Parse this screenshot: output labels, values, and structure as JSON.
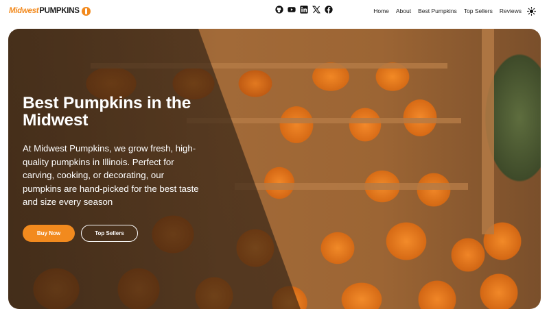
{
  "brand": {
    "logo_word1": "Midwest",
    "logo_word2": "PUMPKINS",
    "accent": "#f28a1e"
  },
  "social_icons": [
    "github-icon",
    "youtube-icon",
    "linkedin-icon",
    "x-icon",
    "facebook-icon"
  ],
  "nav": {
    "home": "Home",
    "about": "About",
    "best_pumpkins": "Best Pumpkins",
    "top_sellers": "Top Sellers",
    "reviews": "Reviews",
    "theme_icon": "sun-icon"
  },
  "hero": {
    "title": "Best Pumpkins in the Midwest",
    "description": "At Midwest Pumpkins, we grow fresh, high-quality pumpkins in Illinois. Perfect for carving, cooking, or decorating, our pumpkins are hand-picked for the best taste and size every season",
    "buy_button": "Buy Now",
    "top_sellers_button": "Top Sellers"
  }
}
